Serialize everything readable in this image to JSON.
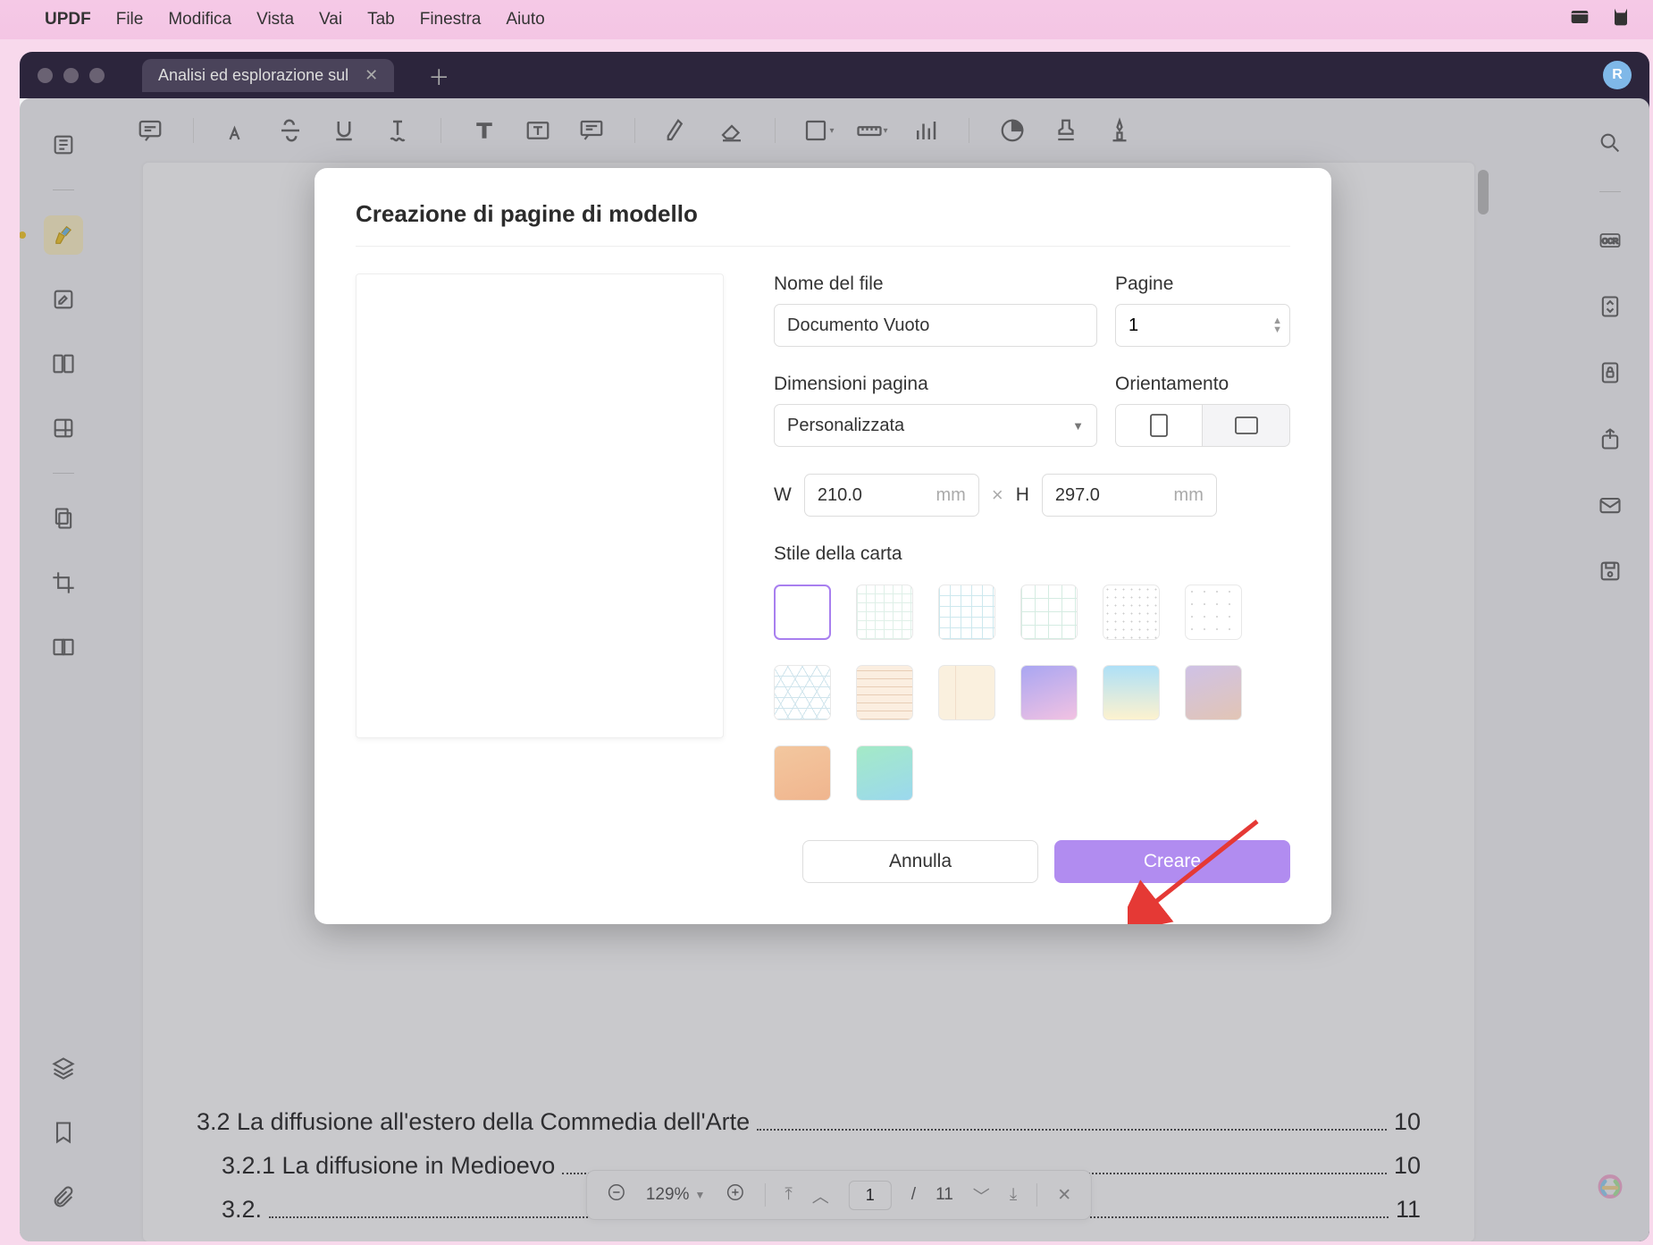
{
  "menubar": {
    "app": "UPDF",
    "items": [
      "File",
      "Modifica",
      "Vista",
      "Vai",
      "Tab",
      "Finestra",
      "Aiuto"
    ]
  },
  "window": {
    "tab_title": "Analisi ed esplorazione sul",
    "avatar_letter": "R"
  },
  "modal": {
    "title": "Creazione di pagine di modello",
    "labels": {
      "filename": "Nome del file",
      "pages": "Pagine",
      "page_size": "Dimensioni pagina",
      "orientation": "Orientamento",
      "paper_style": "Stile della carta",
      "width_abbr": "W",
      "height_abbr": "H",
      "unit": "mm",
      "times": "×"
    },
    "values": {
      "filename": "Documento Vuoto",
      "pages": "1",
      "page_size": "Personalizzata",
      "width": "210.0",
      "height": "297.0"
    },
    "buttons": {
      "cancel": "Annulla",
      "create": "Creare"
    }
  },
  "document": {
    "lines": [
      {
        "text": "3.2 La diffusione all'estero della Commedia dell'Arte",
        "page": "10",
        "indent": false
      },
      {
        "text": "3.2.1 La diffusione in Medioevo",
        "page": "10",
        "indent": true
      },
      {
        "text": "3.2.",
        "page": "11",
        "indent": true
      }
    ]
  },
  "footer": {
    "zoom": "129%",
    "page_current": "1",
    "page_sep": "/",
    "page_total": "11"
  }
}
